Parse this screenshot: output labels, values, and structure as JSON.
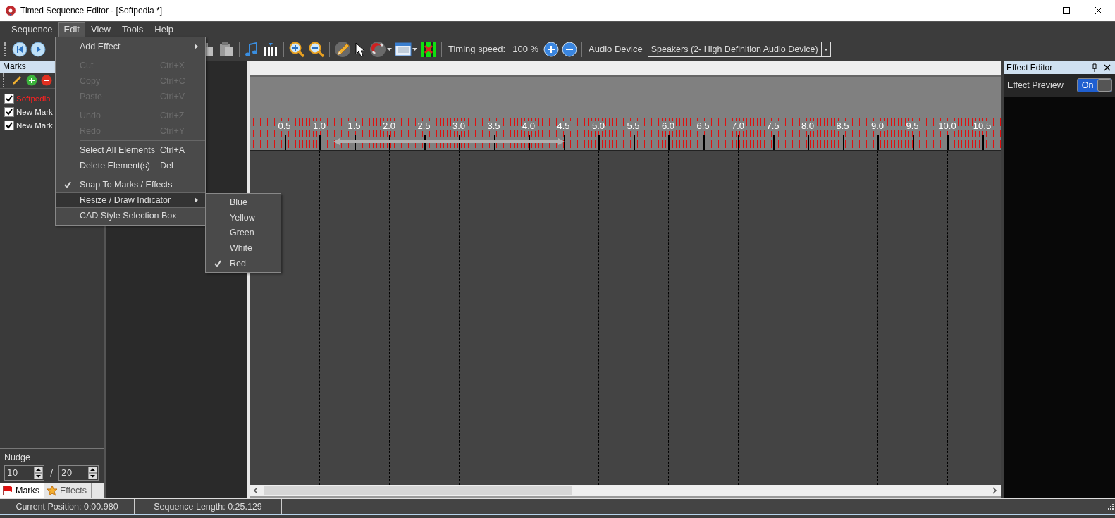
{
  "window": {
    "title": "Timed Sequence Editor - [Softpedia *]"
  },
  "menu_bar": [
    {
      "label": "Sequence",
      "selected": false
    },
    {
      "label": "Edit",
      "selected": true
    },
    {
      "label": "View",
      "selected": false
    },
    {
      "label": "Tools",
      "selected": false
    },
    {
      "label": "Help",
      "selected": false
    }
  ],
  "toolbar": {
    "timing_speed_label": "Timing speed:",
    "timing_speed_value": "100 %",
    "audio_device_label": "Audio Device",
    "audio_device": "Speakers (2- High Definition Audio Device)"
  },
  "marks_panel": {
    "title": "Marks",
    "items": [
      {
        "label": "Softpedia",
        "checked": true,
        "selected": true
      },
      {
        "label": "New Mark",
        "checked": true,
        "selected": false
      },
      {
        "label": "New Mark",
        "checked": true,
        "selected": false
      }
    ],
    "nudge_label": "Nudge",
    "nudge_value_1": "10",
    "nudge_separator": "/",
    "nudge_value_2": "20"
  },
  "bottom_tabs": [
    {
      "label": "Marks",
      "kind": "flag",
      "selected": true
    },
    {
      "label": "Effects",
      "kind": "star",
      "selected": false
    }
  ],
  "timeline": {
    "ruler_labels": [
      "0.5",
      "1.0",
      "1.5",
      "2.0",
      "2.5",
      "3.0",
      "3.5",
      "4.0",
      "4.5",
      "5.0",
      "5.5",
      "6.0",
      "6.5",
      "7.0",
      "7.5",
      "8.0",
      "8.5",
      "9.0",
      "9.5",
      "10.0",
      "10.5"
    ]
  },
  "effect_editor": {
    "title": "Effect Editor",
    "preview_label": "Effect Preview",
    "preview_toggle": {
      "label": "On",
      "on": true
    }
  },
  "edit_menu": [
    {
      "kind": "item",
      "label": "Add Effect",
      "submenu": true,
      "disabled": false,
      "checked": false,
      "selected": false
    },
    {
      "kind": "separator"
    },
    {
      "kind": "item",
      "label": "Cut",
      "shortcut": "Ctrl+X",
      "disabled": true,
      "checked": false,
      "selected": false
    },
    {
      "kind": "item",
      "label": "Copy",
      "shortcut": "Ctrl+C",
      "disabled": true,
      "checked": false,
      "selected": false
    },
    {
      "kind": "item",
      "label": "Paste",
      "shortcut": "Ctrl+V",
      "disabled": true,
      "checked": false,
      "selected": false
    },
    {
      "kind": "separator"
    },
    {
      "kind": "item",
      "label": "Undo",
      "shortcut": "Ctrl+Z",
      "disabled": true,
      "checked": false,
      "selected": false
    },
    {
      "kind": "item",
      "label": "Redo",
      "shortcut": "Ctrl+Y",
      "disabled": true,
      "checked": false,
      "selected": false
    },
    {
      "kind": "separator"
    },
    {
      "kind": "item",
      "label": "Select All Elements",
      "shortcut": "Ctrl+A",
      "disabled": false,
      "checked": false,
      "selected": false
    },
    {
      "kind": "item",
      "label": "Delete Element(s)",
      "shortcut": "Del",
      "disabled": false,
      "checked": false,
      "selected": false
    },
    {
      "kind": "separator"
    },
    {
      "kind": "item",
      "label": "Snap To Marks / Effects",
      "disabled": false,
      "checked": true,
      "selected": false
    },
    {
      "kind": "item",
      "label": "Resize / Draw Indicator",
      "submenu": true,
      "disabled": false,
      "checked": false,
      "selected": true
    },
    {
      "kind": "item",
      "label": "CAD Style Selection Box",
      "disabled": false,
      "checked": false,
      "selected": false
    }
  ],
  "indicator_submenu": [
    {
      "label": "Blue",
      "checked": false
    },
    {
      "label": "Yellow",
      "checked": false
    },
    {
      "label": "Green",
      "checked": false
    },
    {
      "label": "White",
      "checked": false
    },
    {
      "label": "Red",
      "checked": true
    }
  ],
  "status_bar": {
    "current_position": "Current Position:  0:00.980",
    "sequence_length": "Sequence Length:  0:25.129"
  }
}
